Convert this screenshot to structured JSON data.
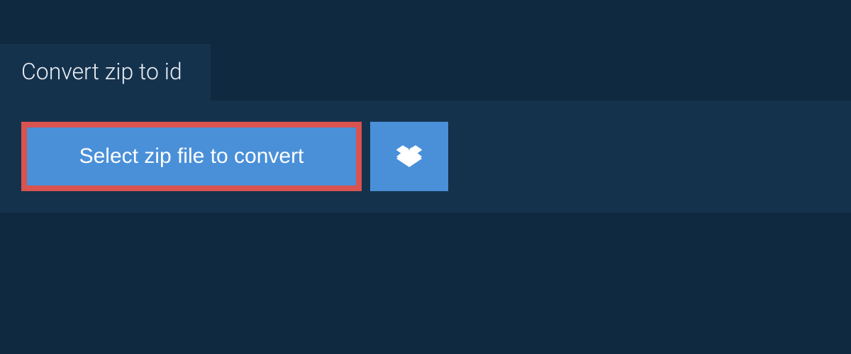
{
  "tab": {
    "label": "Convert zip to id"
  },
  "actions": {
    "select_file_label": "Select zip file to convert"
  },
  "colors": {
    "background_dark": "#0f2940",
    "panel": "#15324d",
    "button_primary": "#4a90d9",
    "button_highlight_border": "#d9534f",
    "text_light": "#e8eef3"
  }
}
